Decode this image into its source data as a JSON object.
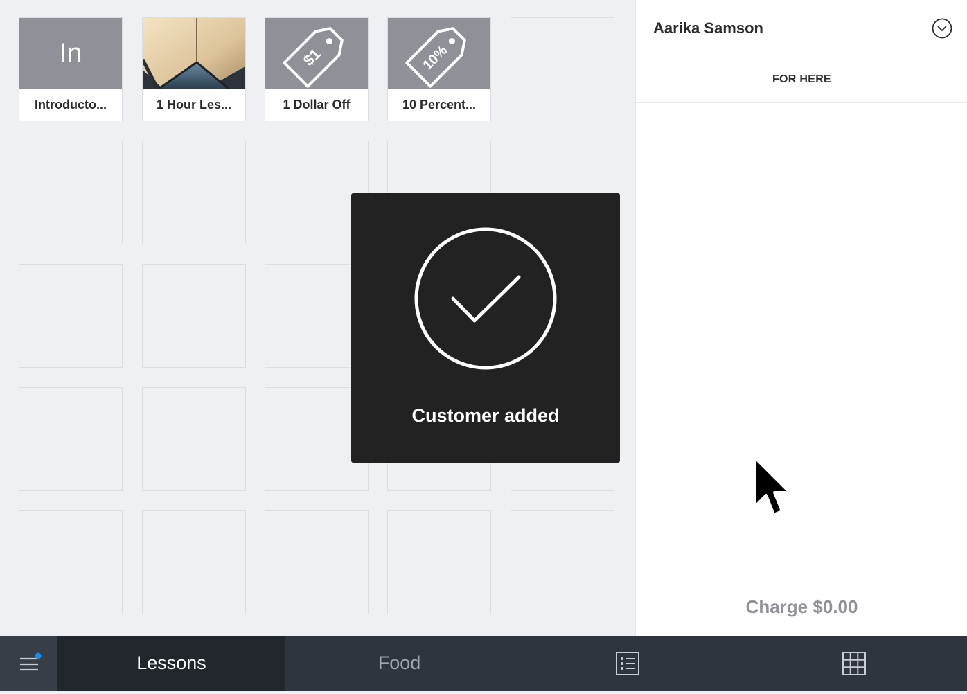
{
  "library": {
    "tiles": [
      {
        "abbr": "In",
        "label": "Introducto..."
      },
      {
        "label": "1 Hour Les..."
      },
      {
        "tag_text": "$1",
        "label": "1 Dollar Off"
      },
      {
        "tag_text": "10%",
        "label": "10 Percent..."
      }
    ]
  },
  "cart": {
    "customer_name": "Aarika Samson",
    "dining_option": "FOR HERE",
    "charge_label": "Charge $0.00"
  },
  "toast": {
    "message": "Customer added",
    "icon": "check-circle-icon"
  },
  "tabs": [
    {
      "label": "Lessons",
      "selected": true
    },
    {
      "label": "Food",
      "selected": false
    }
  ],
  "icons": {
    "menu": "hamburger-menu-icon",
    "list_view": "list-view-icon",
    "grid_view": "grid-view-icon",
    "notification_dot": "#1a8de9"
  }
}
